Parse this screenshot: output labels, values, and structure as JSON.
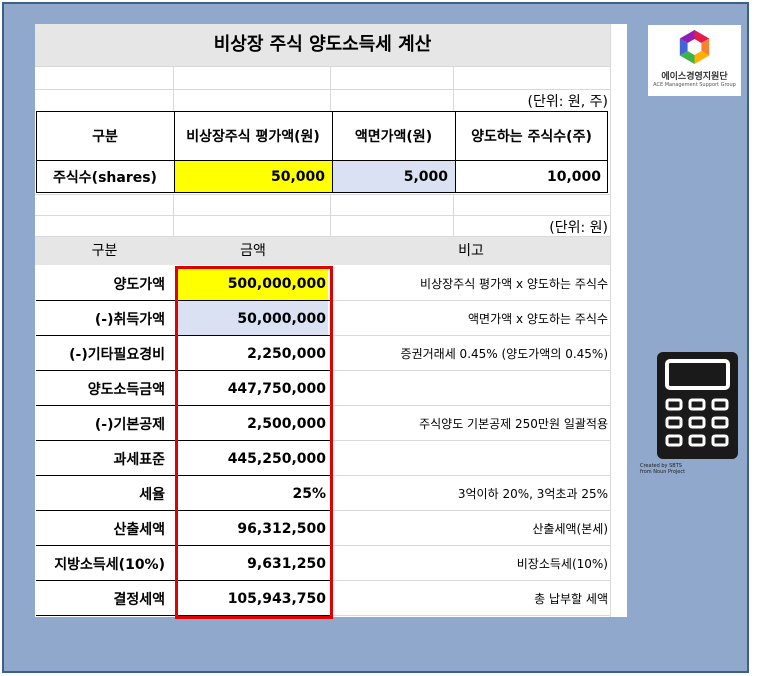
{
  "title": "비상장 주식 양도소득세 계산",
  "unit_top": "(단위: 원, 주)",
  "unit_main": "(단위: 원)",
  "top_table": {
    "headers": [
      "구분",
      "비상장주식 평가액(원)",
      "액면가액(원)",
      "양도하는 주식수(주)"
    ],
    "row": {
      "label": "주식수(shares)",
      "valuation": "50,000",
      "face_value": "5,000",
      "shares": "10,000"
    }
  },
  "main_table": {
    "headers": [
      "구분",
      "금액",
      "비고"
    ],
    "rows": [
      {
        "label": "양도가액",
        "amount": "500,000,000",
        "note": "비상장주식 평가액 x 양도하는 주식수"
      },
      {
        "label": "(-)취득가액",
        "amount": "50,000,000",
        "note": "액면가액 x 양도하는 주식수"
      },
      {
        "label": "(-)기타필요경비",
        "amount": "2,250,000",
        "note": "증권거래세 0.45% (양도가액의 0.45%)"
      },
      {
        "label": "양도소득금액",
        "amount": "447,750,000",
        "note": ""
      },
      {
        "label": "(-)기본공제",
        "amount": "2,500,000",
        "note": "주식양도 기본공제 250만원 일괄적용"
      },
      {
        "label": "과세표준",
        "amount": "445,250,000",
        "note": ""
      },
      {
        "label": "세율",
        "amount": "25%",
        "note": "3억이하 20%, 3억초과 25%"
      },
      {
        "label": "산출세액",
        "amount": "96,312,500",
        "note": "산출세액(본세)"
      },
      {
        "label": "지방소득세(10%)",
        "amount": "9,631,250",
        "note": "비장소득세(10%)"
      },
      {
        "label": "결정세액",
        "amount": "105,943,750",
        "note": "총 납부할 세액"
      }
    ]
  },
  "logo": {
    "name": "에이스경영지원단",
    "subtitle": "ACE Management Support Group",
    "colors": [
      "#e6194b",
      "#f58231",
      "#ffb000",
      "#3cb44b",
      "#4363d8",
      "#911eb4"
    ]
  },
  "calculator_icon": {
    "icon": "calculator-icon",
    "credit": [
      "Created by SBTS",
      "from Noun Project"
    ]
  },
  "colors": {
    "frame_bg": "#8fa8cc",
    "highlight_yellow": "#ffff00",
    "highlight_blue": "#d9e1f2",
    "header_gray": "#e6e6e6",
    "red_box": "#e00000"
  }
}
